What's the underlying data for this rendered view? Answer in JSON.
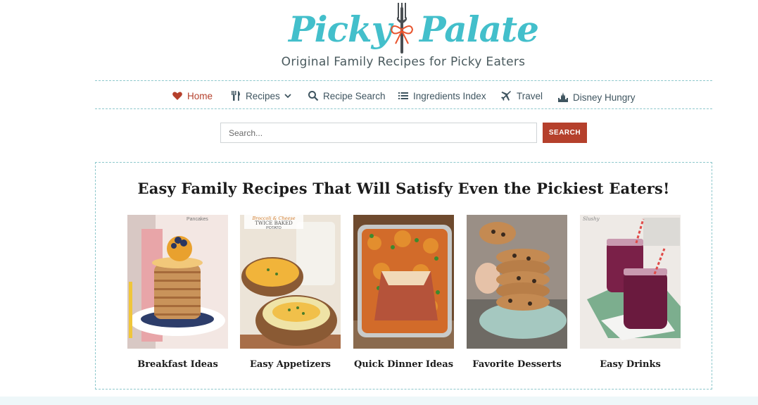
{
  "brand": {
    "logo_word_1": "Picky",
    "logo_word_2": "Palate",
    "tagline": "Original Family Recipes for Picky Eaters",
    "logo_color": "#43bfcb"
  },
  "nav": {
    "items": [
      {
        "label": "Home",
        "icon": "heart-icon",
        "active": true
      },
      {
        "label": "Recipes",
        "icon": "cutlery-icon",
        "has_dropdown": true
      },
      {
        "label": "Recipe Search",
        "icon": "search-icon"
      },
      {
        "label": "Ingredients Index",
        "icon": "list-icon"
      },
      {
        "label": "Travel",
        "icon": "plane-icon"
      },
      {
        "label": "Disney Hungry",
        "icon": "castle-icon"
      }
    ],
    "active_color": "#b5402c"
  },
  "search": {
    "placeholder": "Search...",
    "value": "",
    "button_label": "SEARCH"
  },
  "feature": {
    "title": "Easy Family Recipes That Will Satisfy Even the Pickiest Eaters!",
    "cards": [
      {
        "label": "Breakfast Ideas",
        "image_caption": "Pancakes"
      },
      {
        "label": "Easy Appetizers",
        "image_caption_1": "Broccoli & Cheese",
        "image_caption_2": "TWICE BAKED",
        "image_caption_3": "POTATO"
      },
      {
        "label": "Quick Dinner Ideas"
      },
      {
        "label": "Favorite Desserts"
      },
      {
        "label": "Easy Drinks",
        "image_caption": "Slushy"
      }
    ]
  }
}
